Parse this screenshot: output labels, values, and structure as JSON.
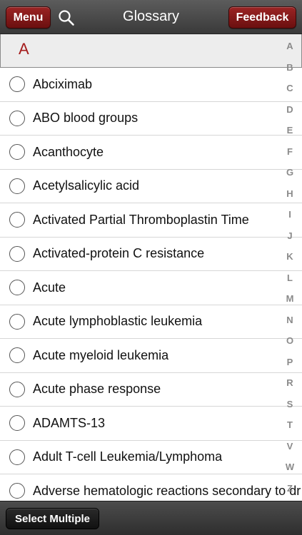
{
  "header": {
    "menu_label": "Menu",
    "title": "Glossary",
    "feedback_label": "Feedback",
    "search_icon": "search-icon"
  },
  "section": {
    "letter": "A"
  },
  "items": [
    "Abciximab",
    "ABO blood groups",
    "Acanthocyte",
    "Acetylsalicylic acid",
    "Activated Partial Thromboplastin Time",
    "Activated-protein C resistance",
    "Acute",
    "Acute lymphoblastic leukemia",
    "Acute myeloid leukemia",
    "Acute phase response",
    "ADAMTS-13",
    "Adult T-cell Leukemia/Lymphoma",
    "Adverse hematologic reactions secondary to dr"
  ],
  "alphabet": [
    "A",
    "B",
    "C",
    "D",
    "E",
    "F",
    "G",
    "H",
    "I",
    "J",
    "K",
    "L",
    "M",
    "N",
    "O",
    "P",
    "R",
    "S",
    "T",
    "V",
    "W",
    "Z"
  ],
  "footer": {
    "select_multiple_label": "Select Multiple"
  },
  "colors": {
    "accent": "#a51d1d",
    "button": "#7d1616",
    "bar": "#4a4a4a"
  }
}
